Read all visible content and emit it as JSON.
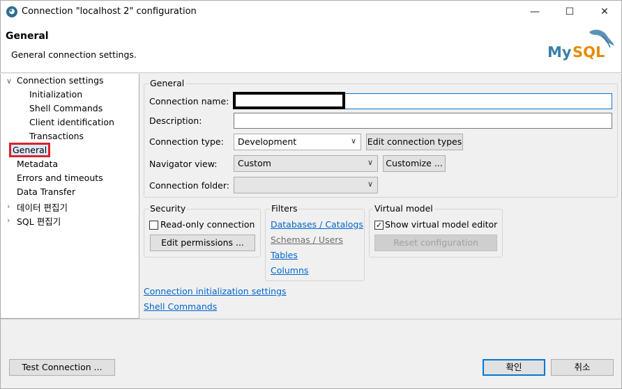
{
  "window": {
    "title": "Connection \"localhost 2\" configuration",
    "icon": "dbeaver-icon",
    "controls": {
      "minimize": "—",
      "maximize": "☐",
      "close": "✕"
    }
  },
  "header": {
    "title": "General",
    "description": "General connection settings.",
    "logo_text": "MySQL"
  },
  "tree": {
    "items": [
      {
        "label": "Connection settings",
        "expanded": true
      },
      {
        "label": "Initialization"
      },
      {
        "label": "Shell Commands"
      },
      {
        "label": "Client identification"
      },
      {
        "label": "Transactions"
      },
      {
        "label": "General",
        "selected": true
      },
      {
        "label": "Metadata"
      },
      {
        "label": "Errors and timeouts"
      },
      {
        "label": "Data Transfer"
      },
      {
        "label": "데이터 편집기",
        "expanded": false
      },
      {
        "label": "SQL 편집기",
        "expanded": false
      }
    ]
  },
  "general": {
    "group_label": "General",
    "connection_name_label": "Connection name:",
    "connection_name_value": "",
    "description_label": "Description:",
    "description_value": "",
    "connection_type_label": "Connection type:",
    "connection_type_value": "Development",
    "edit_connection_types": "Edit connection types",
    "navigator_view_label": "Navigator view:",
    "navigator_view_value": "Custom",
    "customize_button": "Customize ...",
    "connection_folder_label": "Connection folder:",
    "connection_folder_value": ""
  },
  "security": {
    "group_label": "Security",
    "readonly_label": "Read-only connection",
    "readonly_checked": false,
    "edit_permissions": "Edit permissions ..."
  },
  "filters": {
    "group_label": "Filters",
    "links": [
      "Databases / Catalogs",
      "Schemas / Users",
      "Tables",
      "Columns"
    ]
  },
  "virtual_model": {
    "group_label": "Virtual model",
    "show_label": "Show virtual model editor",
    "show_checked": true,
    "reset_button": "Reset configuration"
  },
  "links": {
    "init_settings": "Connection initialization settings",
    "shell_commands": "Shell Commands"
  },
  "footer": {
    "test_connection": "Test Connection ...",
    "ok": "확인",
    "cancel": "취소"
  }
}
